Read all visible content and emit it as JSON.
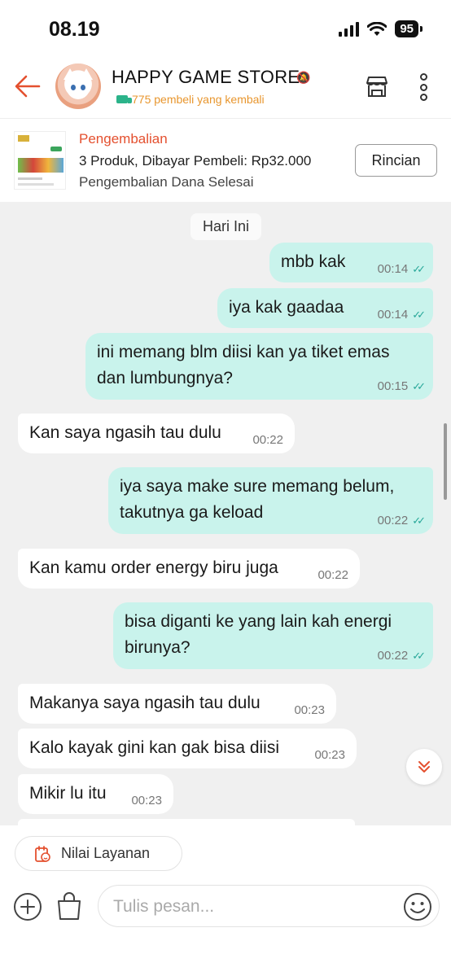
{
  "status_bar": {
    "time": "08.19",
    "battery": "95"
  },
  "header": {
    "store_name": "HAPPY GAME STORE",
    "returning_buyers": "775 pembeli yang kembali"
  },
  "order": {
    "status": "Pengembalian",
    "detail": "3 Produk, Dibayar Pembeli: Rp32.000",
    "refund": "Pengembalian Dana Selesai",
    "details_button": "Rincian"
  },
  "chat": {
    "date_label": "Hari Ini",
    "messages": [
      {
        "side": "out",
        "text": "mbb kak",
        "time": "00:14"
      },
      {
        "side": "out",
        "text": "iya kak gaadaa",
        "time": "00:14"
      },
      {
        "side": "out",
        "text_lines": [
          "ini memang blm diisi kan ya tiket emas",
          "dan lumbungnya?"
        ],
        "time": "00:15"
      },
      {
        "side": "in",
        "text": "Kan saya ngasih tau dulu",
        "time": "00:22"
      },
      {
        "side": "out",
        "text_lines": [
          "iya saya make sure memang belum,",
          "takutnya ga keload"
        ],
        "time": "00:22"
      },
      {
        "side": "in",
        "text": "Kan kamu order energy biru juga",
        "time": "00:22"
      },
      {
        "side": "out",
        "text_lines": [
          "bisa diganti ke yang lain kah energi",
          "birunya?"
        ],
        "time": "00:22"
      },
      {
        "side": "in",
        "text": "Makanya saya ngasih tau dulu",
        "time": "00:23"
      },
      {
        "side": "in",
        "text": "Kalo kayak gini kan gak bisa diisi",
        "time": "00:23"
      },
      {
        "side": "in",
        "text": "Mikir lu itu",
        "time": "00:23"
      }
    ]
  },
  "bottom": {
    "rating_label": "Nilai Layanan",
    "input_placeholder": "Tulis pesan..."
  },
  "colors": {
    "accent": "#e4502f",
    "outgoing_bubble": "#c9f3ec",
    "incoming_bubble": "#ffffff",
    "chat_bg": "#f0f0f0",
    "buyers_text": "#e8962e",
    "read_ticks": "#29a89a"
  },
  "icons": [
    "back-arrow-icon",
    "mute-bell-icon",
    "truck-icon",
    "shop-icon",
    "more-vertical-icon",
    "double-check-icon",
    "scroll-down-icon",
    "rating-icon",
    "plus-icon",
    "bag-icon",
    "emoji-icon"
  ]
}
